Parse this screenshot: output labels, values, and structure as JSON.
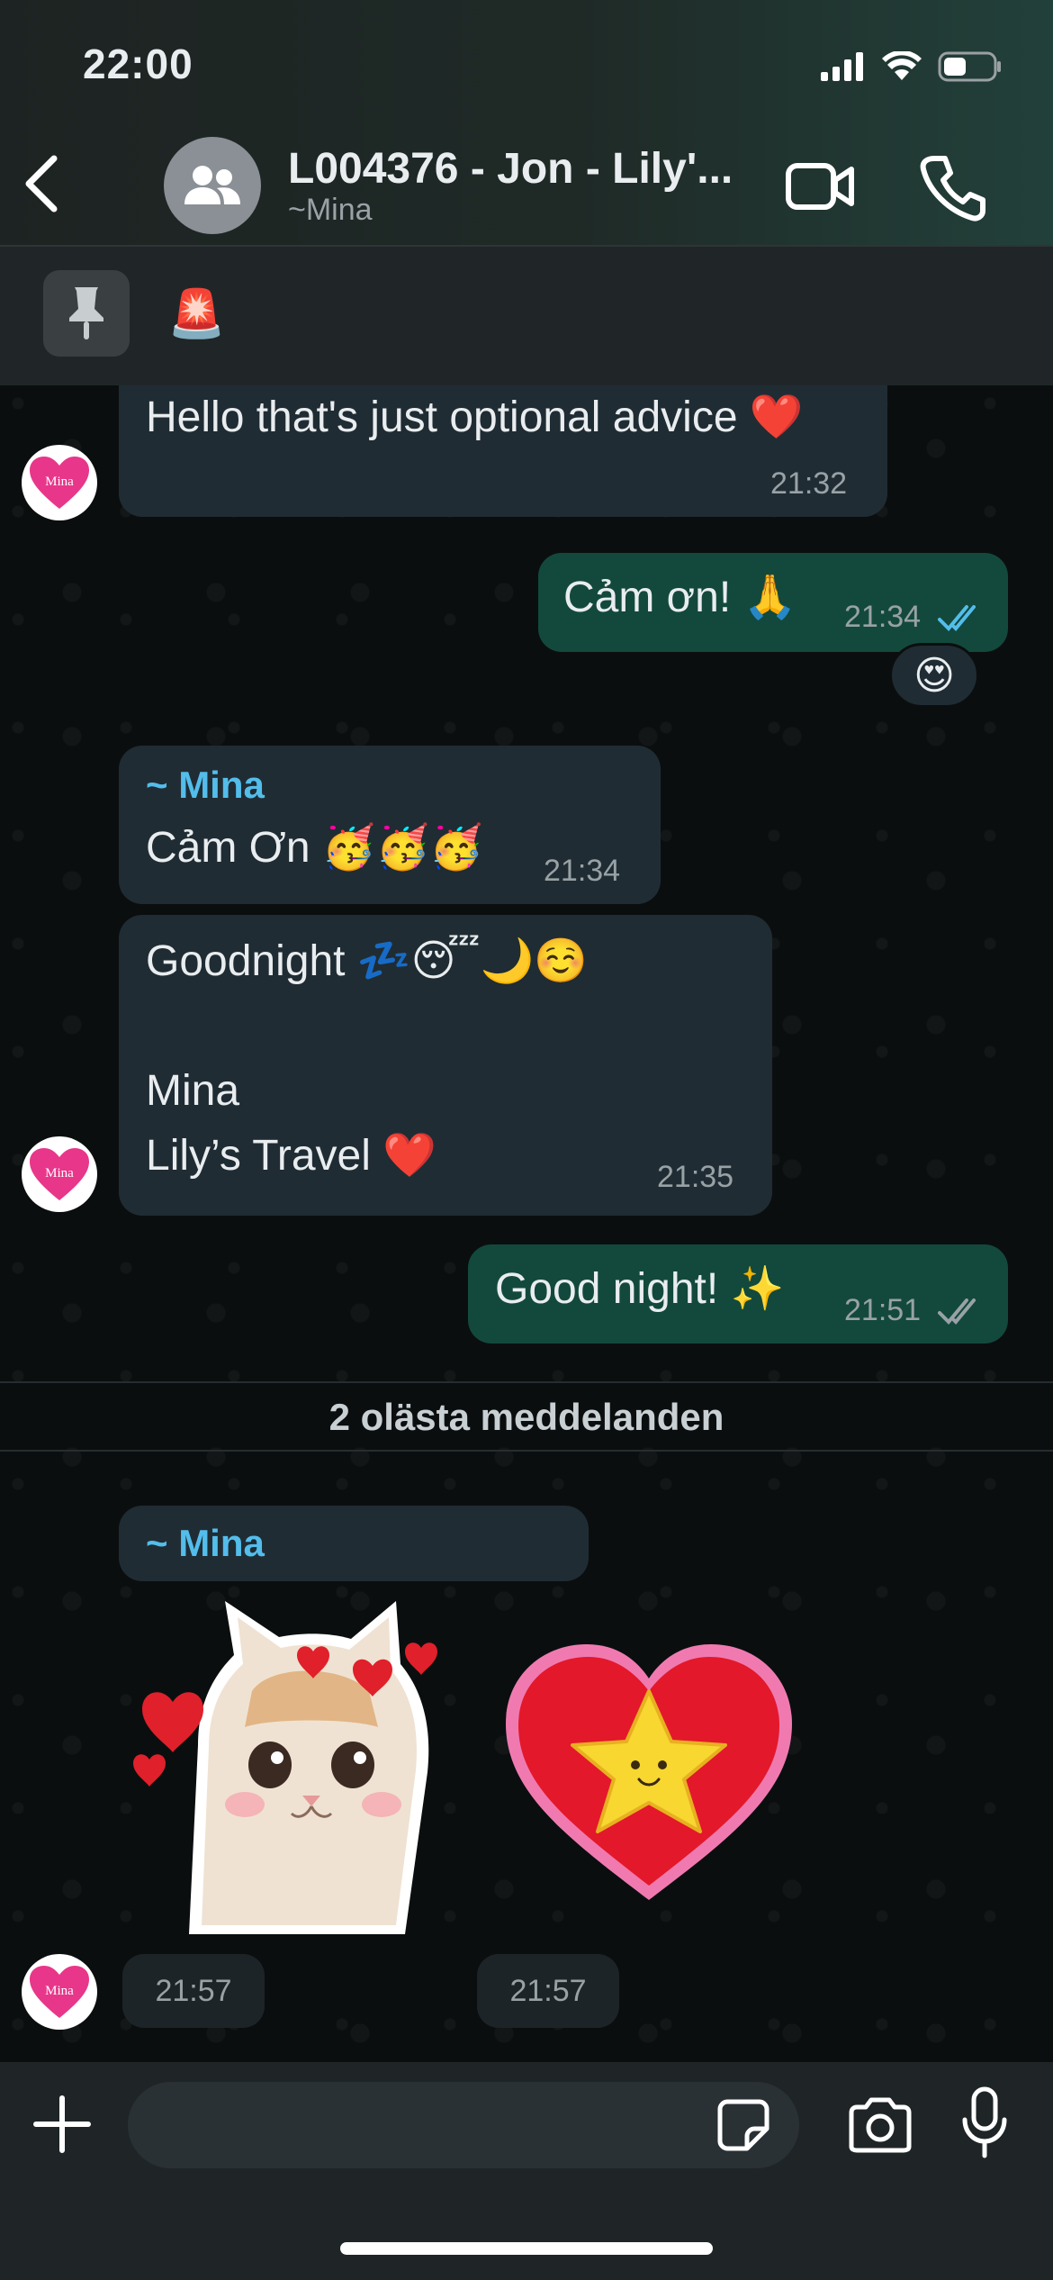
{
  "status_bar": {
    "time": "22:00"
  },
  "header": {
    "title": "L004376 - Jon - Lily'...",
    "subtitle": "~Mina"
  },
  "pinned": {
    "emoji": "🚨"
  },
  "messages": [
    {
      "text": "Hello that's just optional advice ❤️",
      "time": "21:32"
    },
    {
      "text": "Cảm ơn! 🙏",
      "time": "21:34",
      "reaction": "😍"
    },
    {
      "sender": "~ Mina",
      "text": "Cảm Ơn 🥳🥳🥳",
      "time": "21:34"
    },
    {
      "text": "Goodnight 💤😴🌙☺️\n\nMina\nLily’s Travel ❤️",
      "time": "21:35"
    },
    {
      "text": "Good night! ✨",
      "time": "21:51"
    }
  ],
  "unread_divider": "2 olästa meddelanden",
  "sticker_group": {
    "sender": "~ Mina",
    "sticker1_time": "21:57",
    "sticker2_time": "21:57"
  },
  "avatar_label": "Mina",
  "composer": {
    "placeholder": ""
  },
  "colors": {
    "incoming_bubble": "#202c33",
    "outgoing_bubble": "#13493c",
    "sender_name": "#53bdeb",
    "read_ticks": "#53bdeb"
  }
}
